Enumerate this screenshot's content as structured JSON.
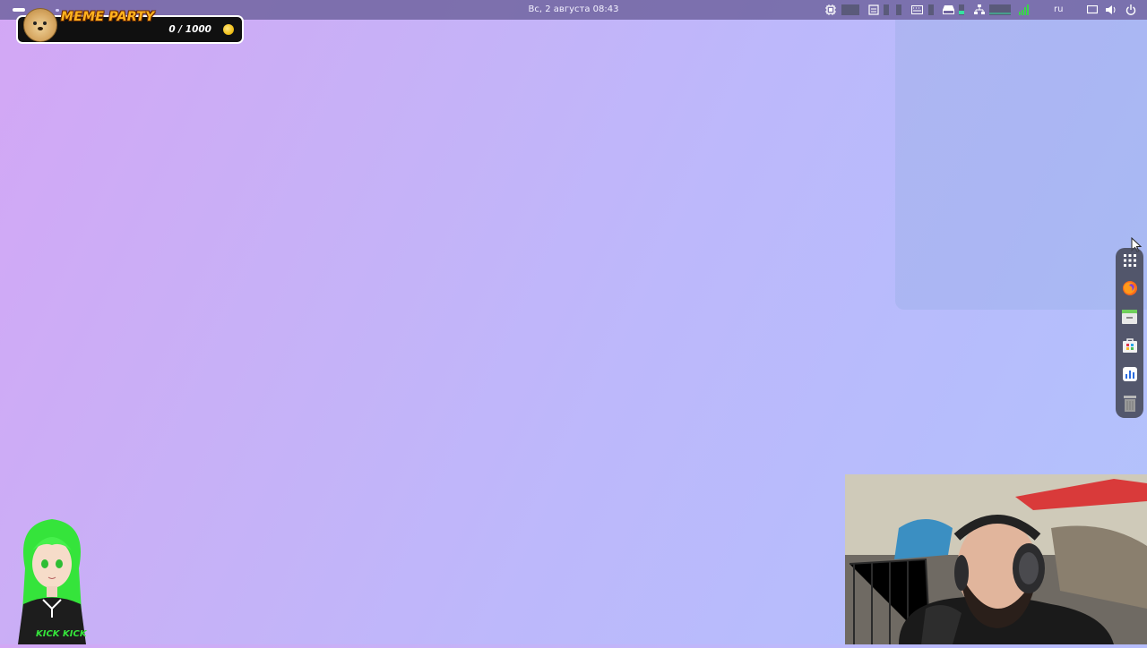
{
  "topbar": {
    "clock": "Вс, 2 августа  08:43",
    "language": "ru"
  },
  "icons": {
    "activities": "activities-indicator",
    "cpu": "cpu-monitor-icon",
    "clipboard": "clipboard-icon",
    "keyboard": "keyboard-icon",
    "drive": "drive-icon",
    "network": "network-icon",
    "signal": "signal-icon",
    "screen": "screen-icon",
    "volume": "volume-icon",
    "power": "power-icon"
  },
  "meme_widget": {
    "title": "MEME PARTY",
    "score": "0 / 1000"
  },
  "dock": {
    "items": [
      {
        "name": "app-grid-icon"
      },
      {
        "name": "firefox-icon"
      },
      {
        "name": "files-icon"
      },
      {
        "name": "software-store-icon"
      },
      {
        "name": "system-monitor-icon"
      },
      {
        "name": "trash-icon"
      }
    ]
  },
  "overlay": {
    "avatar_caption": "KICK KICK"
  },
  "colors": {
    "bg_start": "#d3a7f5",
    "bg_end": "#b2c3fb",
    "topbar": "#7064a0",
    "coin": "#f2c21c",
    "meme_title": "#ffb21e",
    "avatar_hair": "#35e43b"
  }
}
